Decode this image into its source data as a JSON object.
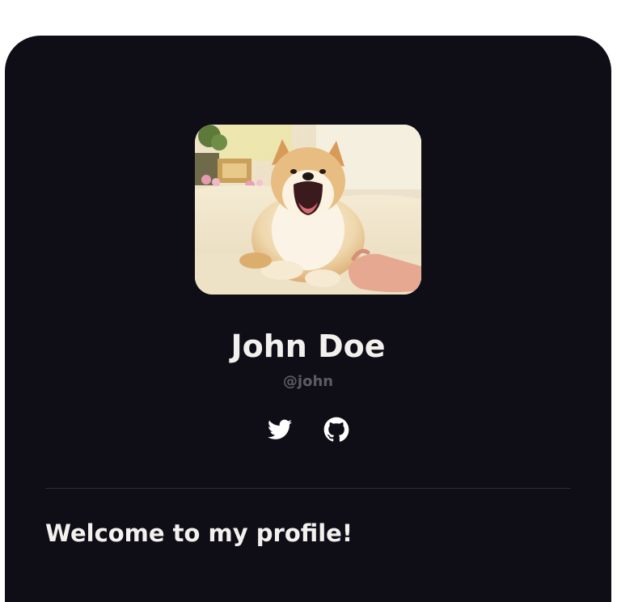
{
  "profile": {
    "name": "John Doe",
    "handle": "@john",
    "welcome_heading": "Welcome to my profile!",
    "avatar": {
      "icon": "shiba-inu-photo"
    }
  },
  "socials": [
    {
      "icon": "twitter-icon",
      "label": "Twitter"
    },
    {
      "icon": "github-icon",
      "label": "GitHub"
    }
  ],
  "colors": {
    "card_background": "#0f0e17",
    "page_background": "#ffffff",
    "primary_text": "#f3f1ee",
    "muted_text": "#5c5b62",
    "divider": "#2c2b33"
  }
}
